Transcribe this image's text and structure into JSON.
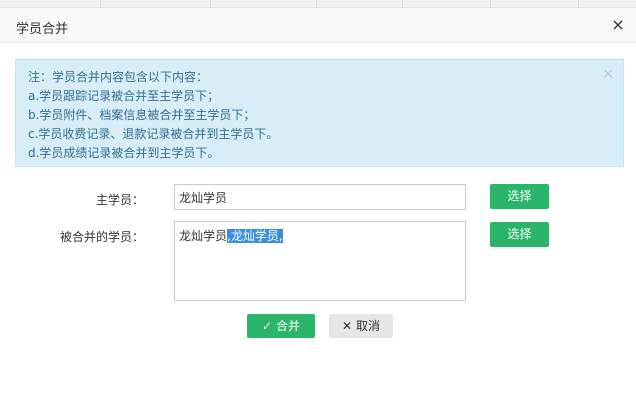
{
  "dialog": {
    "title": "学员合并",
    "close_icon": "×"
  },
  "notice": {
    "close_icon": "×",
    "lines": [
      "注：学员合并内容包含以下内容：",
      "a.学员跟踪记录被合并至主学员下；",
      "b.学员附件、档案信息被合并至主学员下；",
      "c.学员收费记录、退款记录被合并到主学员下。",
      "d.学员成绩记录被合并到主学员下。"
    ]
  },
  "form": {
    "main_student": {
      "label": "主学员：",
      "value": "龙灿学员",
      "select_label": "选择"
    },
    "merged_students": {
      "label": "被合并的学员：",
      "value_prefix": "龙灿学员",
      "value_selected": ",龙灿学员,",
      "select_label": "选择"
    }
  },
  "actions": {
    "merge_icon": "✓",
    "merge_label": "合并",
    "cancel_icon": "✕",
    "cancel_label": "取消"
  },
  "colors": {
    "primary_green": "#2bb56a",
    "notice_bg": "#d9edf7",
    "notice_text": "#31708f",
    "selection": "#3b8de0"
  }
}
